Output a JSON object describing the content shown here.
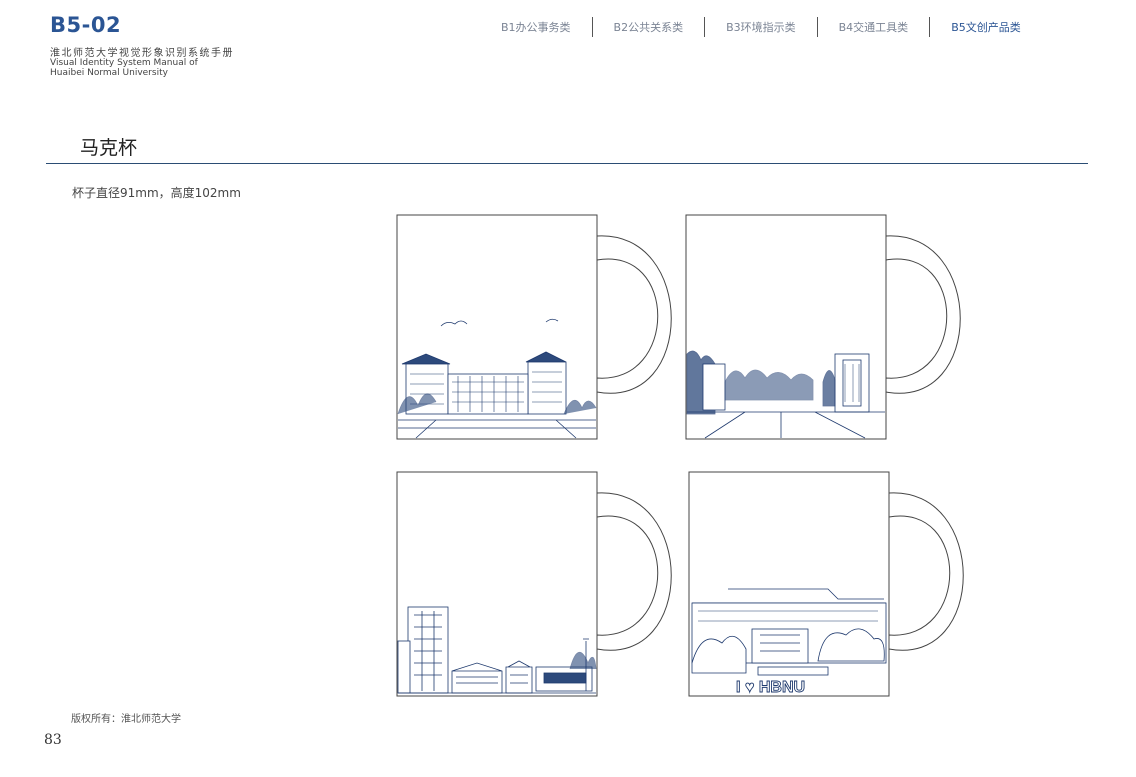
{
  "header": {
    "code": "B5-02",
    "title_cn": "淮北师范大学视觉形象识别系统手册",
    "title_en_line1": "Visual Identity System Manual of",
    "title_en_line2": "Huaibei Normal University"
  },
  "nav": {
    "items": [
      {
        "label": "B1办公事务类",
        "active": false
      },
      {
        "label": "B2公共关系类",
        "active": false
      },
      {
        "label": "B3环境指示类",
        "active": false
      },
      {
        "label": "B4交通工具类",
        "active": false
      },
      {
        "label": "B5文创产品类",
        "active": true
      }
    ]
  },
  "section": {
    "title": "马克杯",
    "spec": "杯子直径91mm，高度102mm"
  },
  "mugs": [
    {
      "illustration": "campus-building-sketch"
    },
    {
      "illustration": "campus-gate-avenue-sketch"
    },
    {
      "illustration": "tower-and-library-sketch"
    },
    {
      "illustration": "library-i-love-hbnu-sketch",
      "slogan": "I ♥ HBNU"
    }
  ],
  "footer": {
    "copyright": "版权所有：淮北师范大学",
    "page_number": "83"
  },
  "colors": {
    "brand_blue": "#2b5594",
    "nav_gray": "#7b8494",
    "illustration_navy": "#1f3a6e",
    "rule": "#2b4d74"
  }
}
